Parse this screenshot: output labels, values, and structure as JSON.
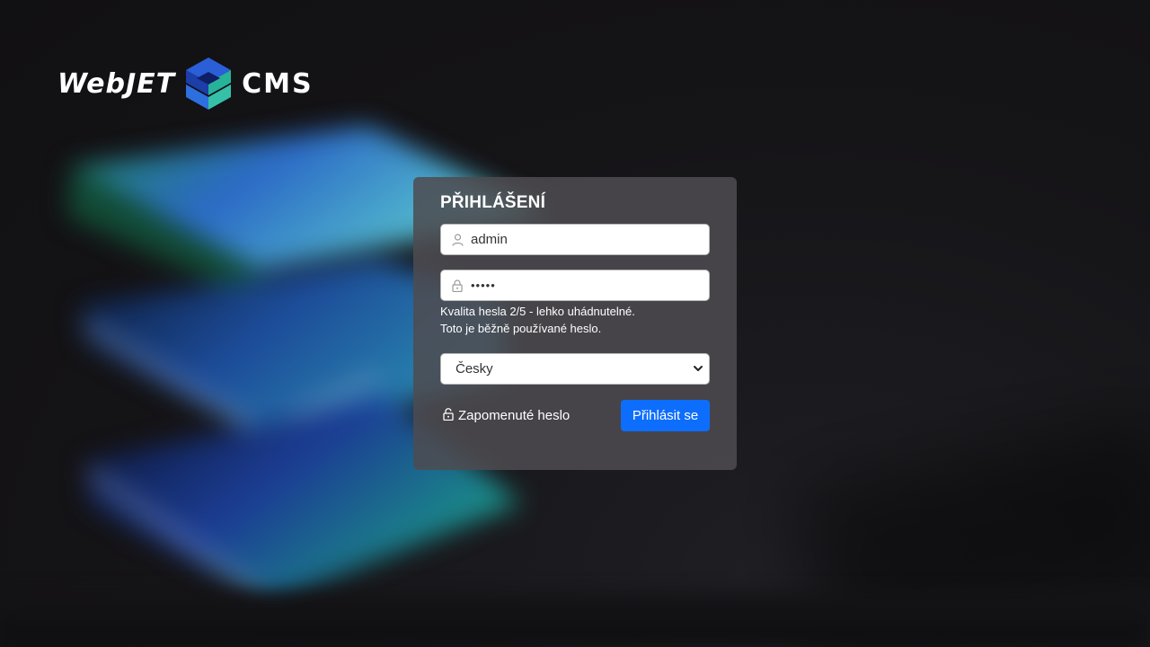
{
  "brand": {
    "logo_text_left": "WebJET",
    "logo_text_right": "CMS",
    "logo_icon": "webjet-cube-logo"
  },
  "login": {
    "title": "PŘIHLÁŠENÍ",
    "username": {
      "value": "admin",
      "icon": "user-icon"
    },
    "password": {
      "masked_value": "•••••",
      "icon": "lock-icon"
    },
    "password_hint_line1": "Kvalita hesla 2/5 - lehko uhádnutelné.",
    "password_hint_line2": "Toto je běžně používané heslo.",
    "language": {
      "selected": "Česky",
      "icon": "chevron-down-icon"
    },
    "forgot_password_label": "Zapomenuté heslo",
    "forgot_password_icon": "unlock-icon",
    "submit_label": "Přihlásit se"
  },
  "colors": {
    "primary_button": "#0d6efd",
    "card_background": "#4e4c50",
    "page_background": "#131215"
  }
}
